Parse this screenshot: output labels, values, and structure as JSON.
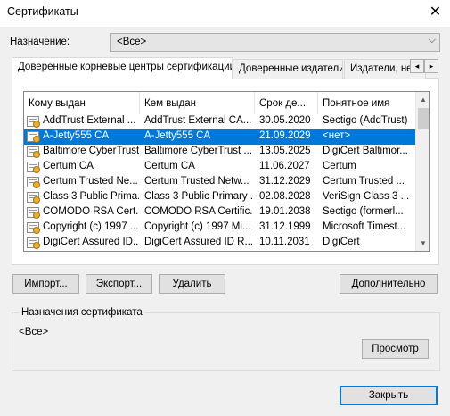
{
  "window": {
    "title": "Сертификаты",
    "close_glyph": "✕"
  },
  "purpose": {
    "label": "Назначение:",
    "value": "<Все>"
  },
  "tabs": [
    {
      "label": "Доверенные корневые центры сертификации",
      "active": true
    },
    {
      "label": "Доверенные издатели",
      "active": false
    },
    {
      "label": "Издатели, не",
      "active": false
    }
  ],
  "tab_scroll": {
    "left": "◂",
    "right": "▸"
  },
  "list": {
    "columns": [
      "Кому выдан",
      "Кем выдан",
      "Срок де...",
      "Понятное имя"
    ],
    "rows": [
      [
        "AddTrust External ...",
        "AddTrust External CA...",
        "30.05.2020",
        "Sectigo (AddTrust)"
      ],
      [
        "A-Jetty555 CA",
        "A-Jetty555 CA",
        "21.09.2029",
        "<нет>"
      ],
      [
        "Baltimore CyberTrust...",
        "Baltimore CyberTrust ...",
        "13.05.2025",
        "DigiCert Baltimor..."
      ],
      [
        "Certum CA",
        "Certum CA",
        "11.06.2027",
        "Certum"
      ],
      [
        "Certum Trusted Ne...",
        "Certum Trusted Netw...",
        "31.12.2029",
        "Certum Trusted ..."
      ],
      [
        "Class 3 Public Prima...",
        "Class 3 Public Primary ...",
        "02.08.2028",
        "VeriSign Class 3 ..."
      ],
      [
        "COMODO RSA Cert...",
        "COMODO RSA Certific...",
        "19.01.2038",
        "Sectigo (formerl..."
      ],
      [
        "Copyright (c) 1997 ...",
        "Copyright (c) 1997 Mi...",
        "31.12.1999",
        "Microsoft Timest..."
      ],
      [
        "DigiCert Assured ID...",
        "DigiCert Assured ID R...",
        "10.11.2031",
        "DigiCert"
      ]
    ],
    "selected_index": 1
  },
  "buttons": {
    "import": "Импорт...",
    "export": "Экспорт...",
    "delete": "Удалить",
    "advanced": "Дополнительно",
    "view": "Просмотр",
    "close": "Закрыть"
  },
  "purposes_group": {
    "label": "Назначения сертификата",
    "value": "<Все>"
  },
  "colors": {
    "selection": "#0078d7",
    "window_bg": "#f0f0f0"
  }
}
